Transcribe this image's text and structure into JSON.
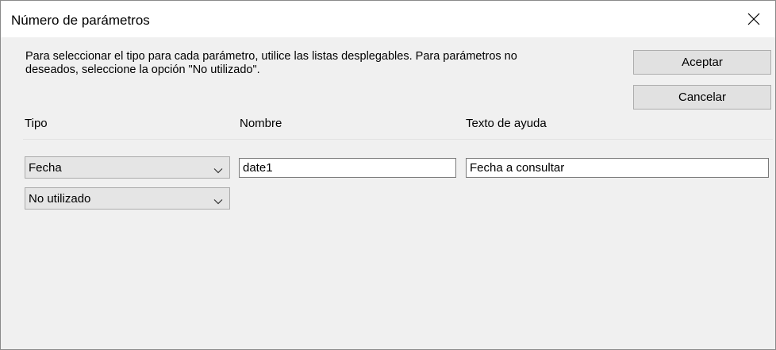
{
  "window": {
    "title": "Número de parámetros"
  },
  "instructions": "Para seleccionar el tipo para cada parámetro, utilice las listas desplegables. Para parámetros no deseados, seleccione la opción \"No utilizado\".",
  "buttons": {
    "ok_label": "Aceptar",
    "cancel_label": "Cancelar"
  },
  "columns": {
    "type": "Tipo",
    "name": "Nombre",
    "help_text": "Texto de ayuda"
  },
  "parameters": [
    {
      "type": "Fecha",
      "name": "date1",
      "help_text": "Fecha a consultar"
    },
    {
      "type": "No utilizado"
    }
  ],
  "icons": {
    "close": "close-icon",
    "dropdown": "chevron-down-icon"
  }
}
